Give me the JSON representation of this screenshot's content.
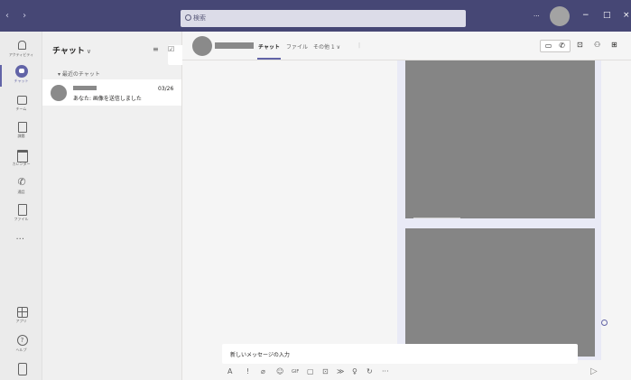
{
  "titlebar": {
    "nav": "‹ ›",
    "search_placeholder": "検索",
    "more": "···",
    "minimize": "−",
    "maximize": "□",
    "close": "×"
  },
  "rail": {
    "items": [
      {
        "label": "アクティビティ",
        "icon": "bell-icon"
      },
      {
        "label": "チャット",
        "icon": "chat-icon",
        "active": true
      },
      {
        "label": "チーム",
        "icon": "teams-icon"
      },
      {
        "label": "課題",
        "icon": "assignment-icon"
      },
      {
        "label": "カレンダー",
        "icon": "calendar-icon"
      },
      {
        "label": "通話",
        "icon": "call-icon"
      },
      {
        "label": "ファイル",
        "icon": "file-icon"
      },
      {
        "label": "",
        "icon": "more-icon"
      },
      {
        "label": "アプリ",
        "icon": "apps-icon"
      },
      {
        "label": "ヘルプ",
        "icon": "help-icon"
      },
      {
        "label": "",
        "icon": "device-icon"
      }
    ]
  },
  "chatlist": {
    "title": "チャット",
    "title_chevron": "∨",
    "filter_icon": "≡",
    "compose_icon": "☑",
    "section": "▾ 最近のチャット",
    "items": [
      {
        "preview": "あなた: 画像を送信しました",
        "date": "03/26"
      }
    ]
  },
  "chat": {
    "tabs": [
      {
        "label": "チャット",
        "active": true
      },
      {
        "label": "ファイル"
      },
      {
        "label": "その他 1 ∨"
      }
    ],
    "tab_sep": "|",
    "header_buttons": {
      "video": "▭",
      "call": "✆",
      "screen": "⊡",
      "people": "⚇",
      "more": "⊞"
    }
  },
  "compose": {
    "placeholder": "新しいメッセージの入力",
    "tools": [
      "A",
      "!",
      "⌀",
      "☺",
      "GIF",
      "▢",
      "⊡",
      "≫",
      "♀",
      "↻",
      "···"
    ],
    "send": "▷"
  },
  "colors": {
    "titlebar": "#464775",
    "accent": "#6264a7",
    "image_placeholder": "#858585"
  }
}
